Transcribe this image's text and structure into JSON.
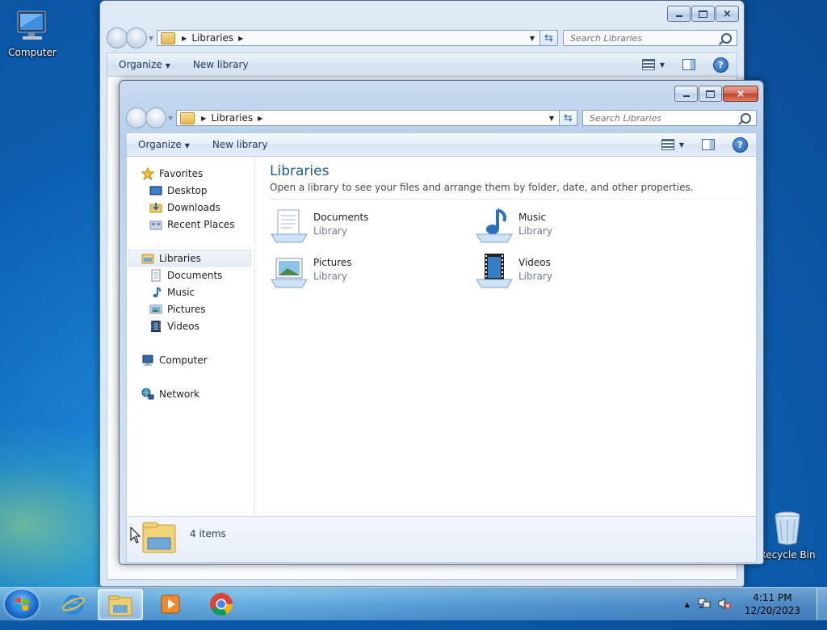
{
  "desktop": {
    "icons": [
      {
        "label": "Computer"
      },
      {
        "label": "Recycle Bin"
      }
    ]
  },
  "back_window": {
    "address": "Libraries",
    "search_placeholder": "Search Libraries",
    "toolbar": {
      "organize": "Organize",
      "new_library": "New library"
    }
  },
  "window": {
    "address": "Libraries",
    "search_placeholder": "Search Libraries",
    "toolbar": {
      "organize": "Organize",
      "new_library": "New library"
    },
    "nav": {
      "favorites": "Favorites",
      "desktop": "Desktop",
      "downloads": "Downloads",
      "recent_places": "Recent Places",
      "libraries": "Libraries",
      "documents": "Documents",
      "music": "Music",
      "pictures": "Pictures",
      "videos": "Videos",
      "computer": "Computer",
      "network": "Network"
    },
    "content": {
      "title": "Libraries",
      "subtitle": "Open a library to see your files and arrange them by folder, date, and other properties.",
      "libraries": [
        {
          "name": "Documents",
          "kind": "Library"
        },
        {
          "name": "Music",
          "kind": "Library"
        },
        {
          "name": "Pictures",
          "kind": "Library"
        },
        {
          "name": "Videos",
          "kind": "Library"
        }
      ]
    },
    "details": {
      "count": "4 items"
    }
  },
  "taskbar": {
    "time": "4:11 PM",
    "date": "12/20/2023"
  }
}
